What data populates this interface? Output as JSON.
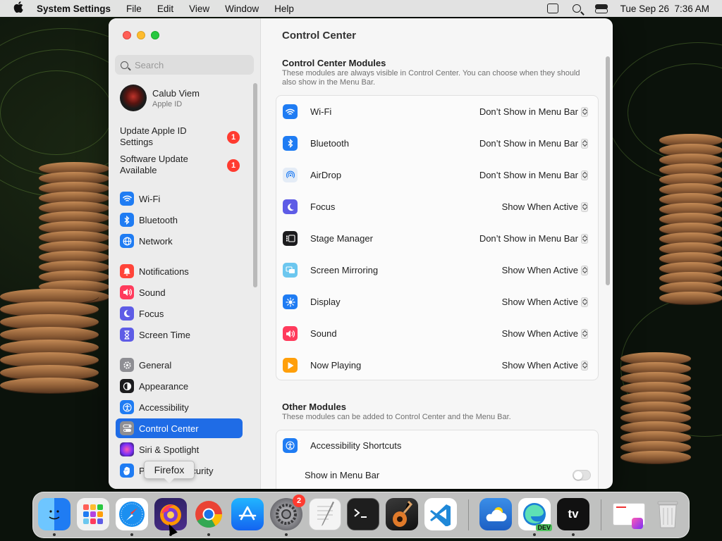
{
  "menubar": {
    "app_name": "System Settings",
    "menus": [
      "File",
      "Edit",
      "View",
      "Window",
      "Help"
    ],
    "clock": "Tue Sep 26  7:36 AM"
  },
  "window": {
    "title": "Control Center",
    "search_placeholder": "Search"
  },
  "profile": {
    "name": "Calub Viem",
    "subtitle": "Apple ID"
  },
  "updates": [
    {
      "label": "Update Apple ID Settings",
      "badge": "1"
    },
    {
      "label": "Software Update Available",
      "badge": "1"
    }
  ],
  "sidebar": {
    "items": [
      {
        "label": "Wi-Fi",
        "icon": "wifi-icon",
        "color": "#1f7cf3"
      },
      {
        "label": "Bluetooth",
        "icon": "bluetooth-icon",
        "color": "#1f7cf3"
      },
      {
        "label": "Network",
        "icon": "globe-icon",
        "color": "#1f7cf3"
      },
      {
        "label": "Notifications",
        "icon": "bell-icon",
        "color": "#ff4439"
      },
      {
        "label": "Sound",
        "icon": "speaker-icon",
        "color": "#ff3b5c"
      },
      {
        "label": "Focus",
        "icon": "moon-icon",
        "color": "#5e5ce6"
      },
      {
        "label": "Screen Time",
        "icon": "hourglass-icon",
        "color": "#5e5ce6"
      },
      {
        "label": "General",
        "icon": "gear-icon",
        "color": "#8e8e93"
      },
      {
        "label": "Appearance",
        "icon": "appearance-icon",
        "color": "#1c1c1e"
      },
      {
        "label": "Accessibility",
        "icon": "accessibility-icon",
        "color": "#1f7cf3"
      },
      {
        "label": "Control Center",
        "icon": "control-center-icon",
        "color": "#8e8e93"
      },
      {
        "label": "Siri & Spotlight",
        "icon": "siri-icon",
        "color": "#b344e0"
      },
      {
        "label": "Privacy & Security",
        "icon": "hand-icon",
        "color": "#1f7cf3"
      }
    ],
    "selected": "Control Center"
  },
  "modules_section": {
    "title": "Control Center Modules",
    "description": "These modules are always visible in Control Center. You can choose when they should also show in the Menu Bar.",
    "rows": [
      {
        "label": "Wi-Fi",
        "value": "Don’t Show in Menu Bar",
        "icon": "wifi-icon",
        "color": "#1f7cf3"
      },
      {
        "label": "Bluetooth",
        "value": "Don’t Show in Menu Bar",
        "icon": "bluetooth-icon",
        "color": "#1f7cf3"
      },
      {
        "label": "AirDrop",
        "value": "Don’t Show in Menu Bar",
        "icon": "airdrop-icon",
        "color": "#e4ecf6"
      },
      {
        "label": "Focus",
        "value": "Show When Active",
        "icon": "moon-icon",
        "color": "#5e5ce6"
      },
      {
        "label": "Stage Manager",
        "value": "Don’t Show in Menu Bar",
        "icon": "stage-manager-icon",
        "color": "#1c1c1e"
      },
      {
        "label": "Screen Mirroring",
        "value": "Show When Active",
        "icon": "screen-mirroring-icon",
        "color": "#6cc7ef"
      },
      {
        "label": "Display",
        "value": "Show When Active",
        "icon": "sun-icon",
        "color": "#1f7cf3"
      },
      {
        "label": "Sound",
        "value": "Show When Active",
        "icon": "speaker-icon",
        "color": "#ff3b5c"
      },
      {
        "label": "Now Playing",
        "value": "Show When Active",
        "icon": "play-icon",
        "color": "#ff9f0a"
      }
    ]
  },
  "other_section": {
    "title": "Other Modules",
    "description": "These modules can be added to Control Center and the Menu Bar.",
    "rows": [
      {
        "label": "Accessibility Shortcuts",
        "icon": "accessibility-icon",
        "color": "#1f7cf3"
      },
      {
        "label": "Show in Menu Bar",
        "toggle": false
      }
    ]
  },
  "tooltip": "Firefox",
  "dock": {
    "apps": [
      {
        "name": "finder-icon",
        "color": "#2a8cf0",
        "running": true
      },
      {
        "name": "launchpad-icon",
        "color": "#f2f2f2",
        "running": false
      },
      {
        "name": "safari-icon",
        "color": "#1b8ff0",
        "running": true
      },
      {
        "name": "firefox-icon",
        "color": "#3d2e86",
        "running": true
      },
      {
        "name": "chrome-icon",
        "color": "#ffffff",
        "running": true
      },
      {
        "name": "app-store-icon",
        "color": "#1c8ef5",
        "running": false
      },
      {
        "name": "system-settings-icon",
        "color": "#8a8a8e",
        "running": true,
        "badge": "2"
      },
      {
        "name": "textedit-icon",
        "color": "#f4f4f4",
        "running": false
      },
      {
        "name": "terminal-icon",
        "color": "#1e1e1e",
        "running": false
      },
      {
        "name": "garageband-icon",
        "color": "#2a2a2a",
        "running": false
      },
      {
        "name": "vscode-icon",
        "color": "#ffffff",
        "running": false
      },
      {
        "name": "weather-icon",
        "color": "#2f7ed8",
        "running": false
      },
      {
        "name": "edge-dev-icon",
        "color": "#ffffff",
        "running": true,
        "label": "DEV"
      },
      {
        "name": "apple-tv-icon",
        "color": "#111111",
        "running": true,
        "label": "tv"
      },
      {
        "name": "downloads-stack-icon",
        "color": "#f1f1f1",
        "running": false
      },
      {
        "name": "trash-icon",
        "color": "#dcdcdc",
        "running": false
      }
    ]
  }
}
